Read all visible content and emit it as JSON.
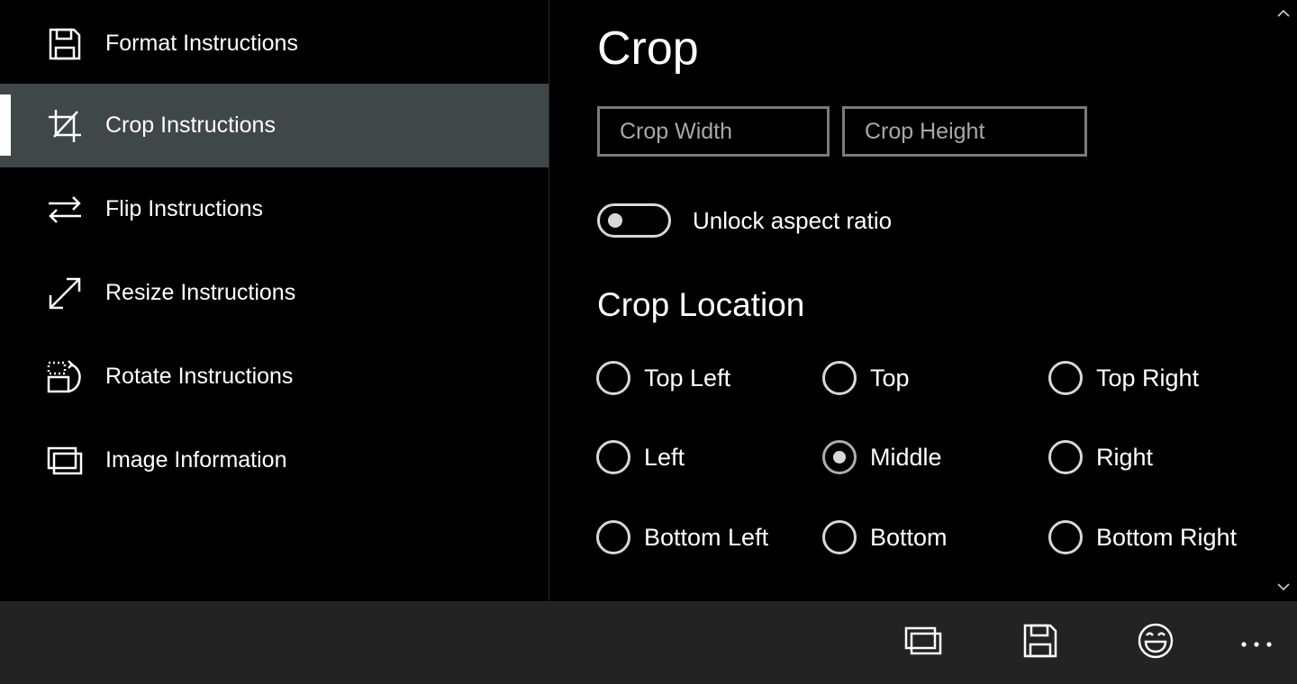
{
  "sidebar": {
    "items": [
      {
        "label": "Format Instructions",
        "icon": "floppy-disk-icon"
      },
      {
        "label": "Crop Instructions",
        "icon": "crop-icon",
        "selected": true
      },
      {
        "label": "Flip Instructions",
        "icon": "flip-arrows-icon"
      },
      {
        "label": "Resize Instructions",
        "icon": "resize-arrow-icon"
      },
      {
        "label": "Rotate Instructions",
        "icon": "rotate-icon"
      },
      {
        "label": "Image Information",
        "icon": "image-stack-icon"
      }
    ]
  },
  "main": {
    "title": "Crop",
    "crop_width": {
      "value": "",
      "placeholder": "Crop Width"
    },
    "crop_height": {
      "value": "",
      "placeholder": "Crop Height"
    },
    "toggle": {
      "label": "Unlock aspect ratio",
      "on": false
    },
    "section_title": "Crop Location",
    "radios": [
      {
        "label": "Top Left",
        "checked": false
      },
      {
        "label": "Top",
        "checked": false
      },
      {
        "label": "Top Right",
        "checked": false
      },
      {
        "label": "Left",
        "checked": false
      },
      {
        "label": "Middle",
        "checked": true
      },
      {
        "label": "Right",
        "checked": false
      },
      {
        "label": "Bottom Left",
        "checked": false
      },
      {
        "label": "Bottom",
        "checked": false
      },
      {
        "label": "Bottom Right",
        "checked": false
      }
    ]
  },
  "bottom_bar": {
    "buttons": [
      {
        "icon": "image-stack-icon"
      },
      {
        "icon": "save-icon"
      },
      {
        "icon": "smiley-icon"
      },
      {
        "icon": "more-icon"
      }
    ]
  },
  "colors": {
    "background": "#000000",
    "selected_nav": "#404749",
    "bottom_bar": "#232323",
    "border": "#7a7a7a"
  }
}
